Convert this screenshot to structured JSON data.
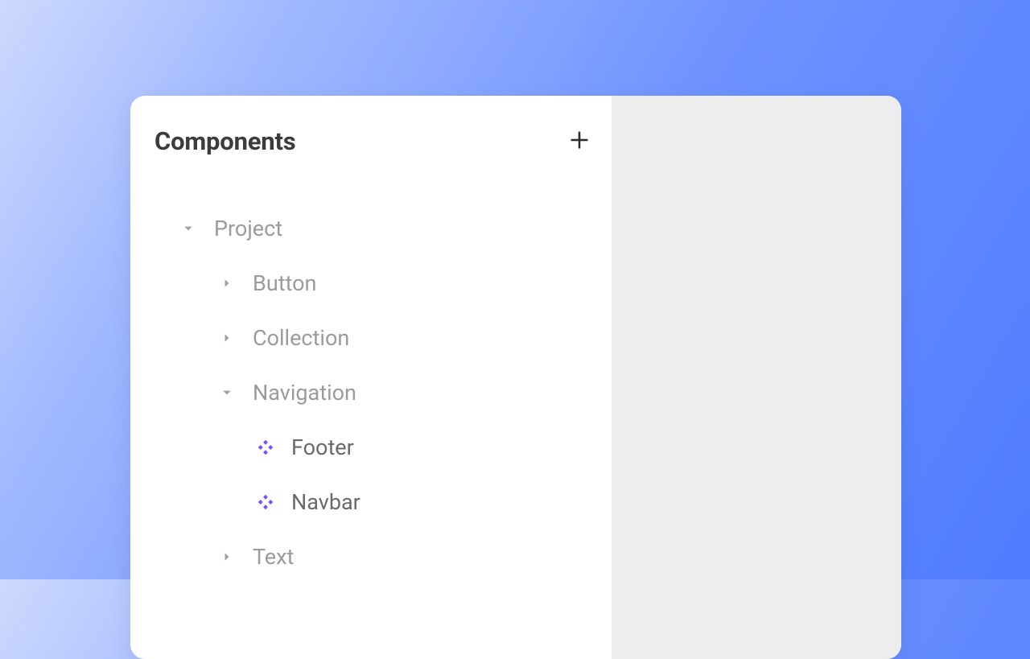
{
  "panel": {
    "title": "Components"
  },
  "tree": {
    "root": {
      "label": "Project",
      "children": [
        {
          "label": "Button"
        },
        {
          "label": "Collection"
        },
        {
          "label": "Navigation",
          "children": [
            {
              "label": "Footer"
            },
            {
              "label": "Navbar"
            }
          ]
        },
        {
          "label": "Text"
        }
      ]
    }
  },
  "colors": {
    "component_icon": "#7c4dff"
  }
}
